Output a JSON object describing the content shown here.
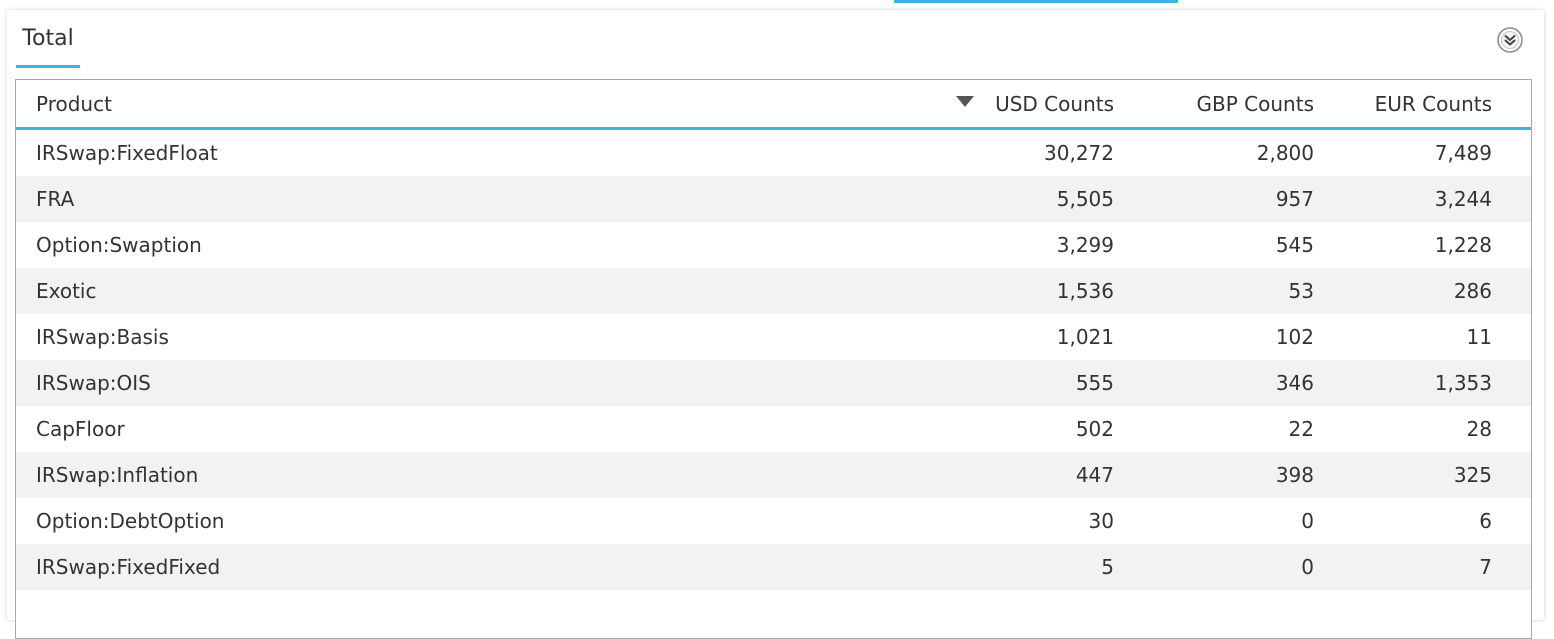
{
  "panel": {
    "tab_label": "Total",
    "collapse_icon": "double-chevron-down-icon"
  },
  "table": {
    "columns": [
      "Product",
      "USD Counts",
      "GBP Counts",
      "EUR Counts"
    ],
    "sort": {
      "column": "USD Counts",
      "direction": "descending"
    },
    "rows": [
      {
        "product": "IRSwap:FixedFloat",
        "usd": "30,272",
        "gbp": "2,800",
        "eur": "7,489"
      },
      {
        "product": "FRA",
        "usd": "5,505",
        "gbp": "957",
        "eur": "3,244"
      },
      {
        "product": "Option:Swaption",
        "usd": "3,299",
        "gbp": "545",
        "eur": "1,228"
      },
      {
        "product": "Exotic",
        "usd": "1,536",
        "gbp": "53",
        "eur": "286"
      },
      {
        "product": "IRSwap:Basis",
        "usd": "1,021",
        "gbp": "102",
        "eur": "11"
      },
      {
        "product": "IRSwap:OIS",
        "usd": "555",
        "gbp": "346",
        "eur": "1,353"
      },
      {
        "product": "CapFloor",
        "usd": "502",
        "gbp": "22",
        "eur": "28"
      },
      {
        "product": "IRSwap:Inflation",
        "usd": "447",
        "gbp": "398",
        "eur": "325"
      },
      {
        "product": "Option:DebtOption",
        "usd": "30",
        "gbp": "0",
        "eur": "6"
      },
      {
        "product": "IRSwap:FixedFixed",
        "usd": "5",
        "gbp": "0",
        "eur": "7"
      }
    ]
  },
  "colors": {
    "accent": "#39b4e3",
    "stripe": "#f2f2f2",
    "border": "#a9a9a9",
    "text": "#333333"
  }
}
